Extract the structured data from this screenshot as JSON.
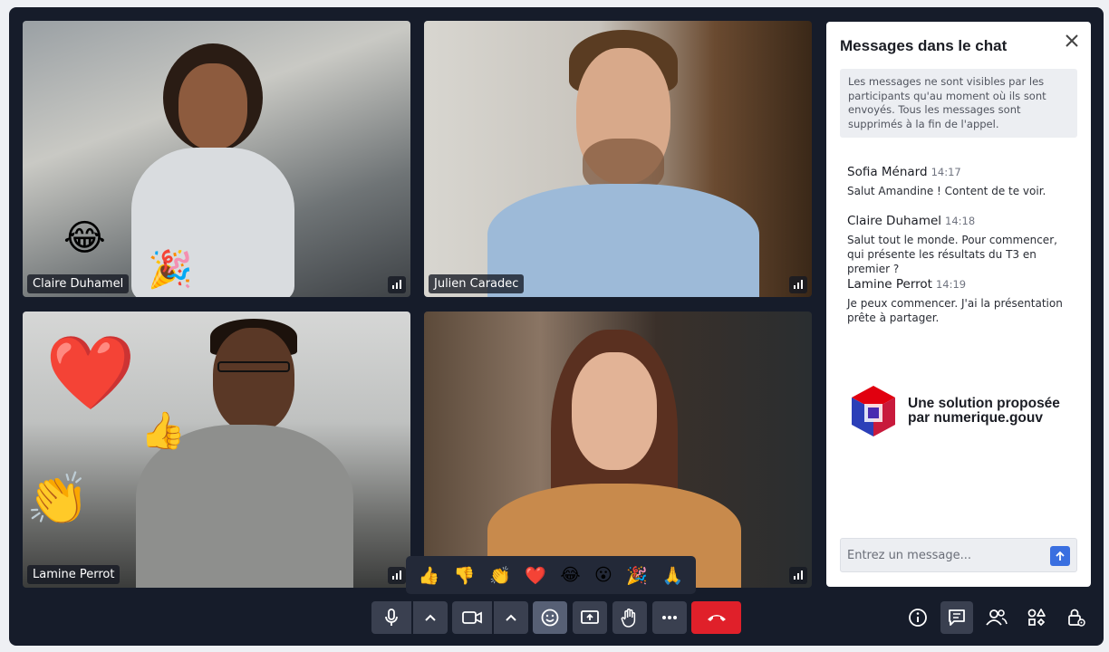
{
  "participants": [
    {
      "name": "Claire Duhamel"
    },
    {
      "name": "Julien Caradec"
    },
    {
      "name": "Lamine Perrot"
    },
    {
      "name": ""
    }
  ],
  "chat": {
    "title": "Messages dans le chat",
    "notice": "Les messages ne sont visibles par les participants qu'au moment où ils sont envoyés. Tous les messages sont supprimés à la fin de l'appel.",
    "messages": [
      {
        "author": "Sofia Ménard",
        "time": "14:17",
        "text": "Salut Amandine ! Content de te voir."
      },
      {
        "author": "Claire Duhamel",
        "time": "14:18",
        "text": "Salut tout le monde. Pour commencer, qui présente les résultats du T3 en premier ?"
      },
      {
        "author": "Lamine Perrot",
        "time": "14:19",
        "text": "Je peux commencer. J'ai la présentation prête à partager."
      }
    ],
    "logo_line1": "Une solution proposée",
    "logo_line2": "par numerique.gouv",
    "input_placeholder": "Entrez un message..."
  },
  "reactions": [
    "👍",
    "👎",
    "👏",
    "❤️",
    "😂",
    "😮",
    "🎉",
    "🙏"
  ],
  "floating_emojis": [
    "😂",
    "🎉",
    "❤️",
    "👍",
    "👏"
  ],
  "colors": {
    "background": "#161c2a",
    "control": "#3a4050",
    "hangup": "#e0202a",
    "send": "#3a6fe0"
  }
}
